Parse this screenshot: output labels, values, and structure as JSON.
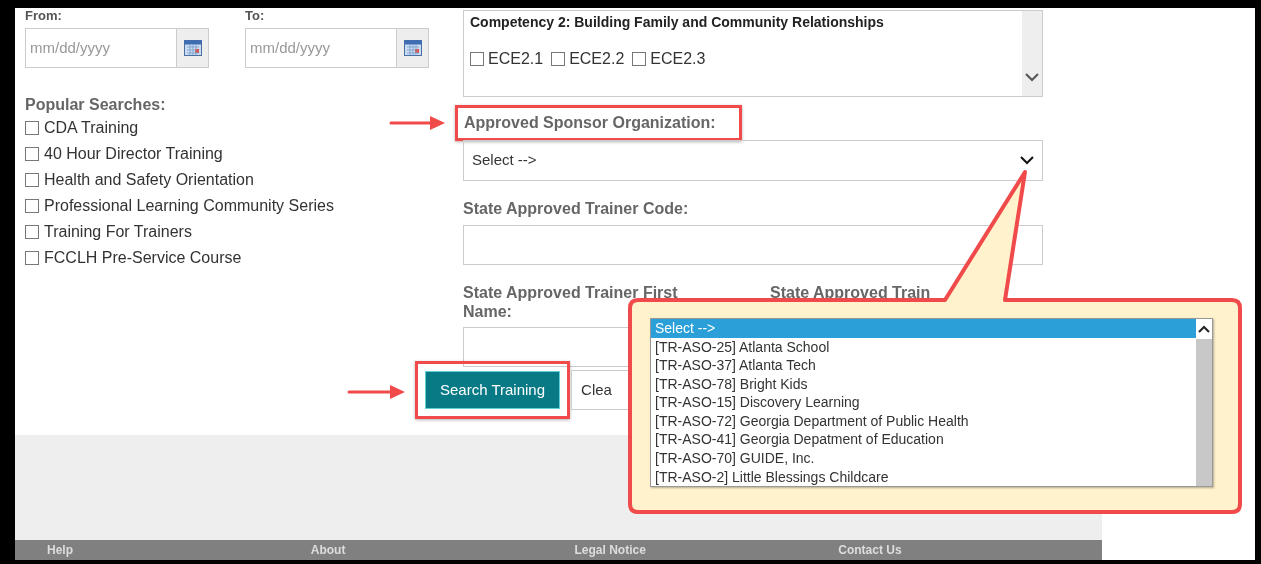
{
  "dates": [
    {
      "label": "From:",
      "placeholder": "mm/dd/yyyy"
    },
    {
      "label": "To:",
      "placeholder": "mm/dd/yyyy"
    }
  ],
  "popular_searches": {
    "title": "Popular Searches:",
    "items": [
      {
        "label": "CDA Training",
        "checked": false
      },
      {
        "label": "40 Hour Director Training",
        "checked": false
      },
      {
        "label": "Health and Safety Orientation",
        "checked": false
      },
      {
        "label": "Professional Learning Community Series",
        "checked": false
      },
      {
        "label": "Training For Trainers",
        "checked": false
      },
      {
        "label": "FCCLH Pre-Service Course",
        "checked": false
      }
    ]
  },
  "competency": {
    "title": "Competency 2: Building Family and Community Relationships",
    "options": [
      {
        "label": "ECE2.1",
        "checked": false
      },
      {
        "label": "ECE2.2",
        "checked": false
      },
      {
        "label": "ECE2.3",
        "checked": false
      }
    ]
  },
  "sponsor": {
    "label": "Approved Sponsor Organization:",
    "value": "Select -->"
  },
  "trainer_code": {
    "label": "State Approved Trainer Code:"
  },
  "trainer_first_name": {
    "label": "State Approved Trainer First Name:"
  },
  "trainer_last_name": {
    "label": "State Approved Train"
  },
  "buttons": [
    {
      "label": "Search Training",
      "kind": "primary"
    },
    {
      "label": "Clea",
      "kind": "secondary"
    }
  ],
  "callout": {
    "options": [
      {
        "label": "Select -->",
        "selected": true
      },
      {
        "label": "[TR-ASO-25] Atlanta School",
        "selected": false
      },
      {
        "label": "[TR-ASO-37] Atlanta Tech",
        "selected": false
      },
      {
        "label": "[TR-ASO-78] Bright Kids",
        "selected": false
      },
      {
        "label": "[TR-ASO-15] Discovery Learning",
        "selected": false
      },
      {
        "label": "[TR-ASO-72] Georgia Department of Public Health",
        "selected": false
      },
      {
        "label": "[TR-ASO-41] Georgia Depatment of Education",
        "selected": false
      },
      {
        "label": "[TR-ASO-70] GUIDE, Inc.",
        "selected": false
      },
      {
        "label": "[TR-ASO-2] Little Blessings Childcare",
        "selected": false
      }
    ]
  },
  "footer": {
    "links": [
      "Help",
      "About",
      "Legal Notice",
      "Contact Us"
    ]
  }
}
